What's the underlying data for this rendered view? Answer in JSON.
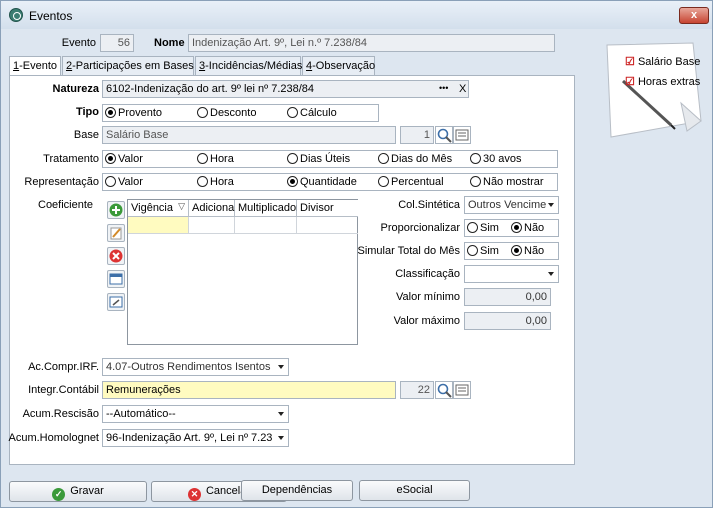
{
  "window": {
    "title": "Eventos",
    "close_label": "x"
  },
  "header": {
    "evento_label": "Evento",
    "evento_value": "56",
    "nome_label": "Nome",
    "nome_value": "Indenização Art. 9º, Lei n.º 7.238/84"
  },
  "tabs": [
    {
      "key": "1",
      "label": "-Evento"
    },
    {
      "key": "2",
      "label": "-Participações em Bases"
    },
    {
      "key": "3",
      "label": "-Incidências/Médias"
    },
    {
      "key": "4",
      "label": "-Observação"
    }
  ],
  "natureza": {
    "label": "Natureza",
    "value": "6102-Indenização do art. 9º lei nº 7.238/84",
    "dots": "•••",
    "clear": "X"
  },
  "tipo": {
    "label": "Tipo",
    "options": [
      "Provento",
      "Desconto",
      "Cálculo"
    ]
  },
  "base": {
    "label": "Base",
    "value": "Salário Base",
    "code": "1"
  },
  "tratamento": {
    "label": "Tratamento",
    "options": [
      "Valor",
      "Hora",
      "Dias Úteis",
      "Dias do Mês",
      "30 avos"
    ]
  },
  "representacao": {
    "label": "Representação",
    "options": [
      "Valor",
      "Hora",
      "Quantidade",
      "Percentual",
      "Não mostrar"
    ]
  },
  "coeficiente": {
    "label": "Coeficiente",
    "columns": [
      "Vigência",
      "Adicional",
      "Multiplicador",
      "Divisor"
    ]
  },
  "right": {
    "col_sintetica": {
      "label": "Col.Sintética",
      "value": "Outros Vencime"
    },
    "proporcionalizar": {
      "label": "Proporcionalizar",
      "options": [
        "Sim",
        "Não"
      ]
    },
    "simular": {
      "label": "Simular Total do Mês",
      "options": [
        "Sim",
        "Não"
      ]
    },
    "classificacao": {
      "label": "Classificação",
      "value": ""
    },
    "valor_minimo": {
      "label": "Valor mínimo",
      "value": "0,00"
    },
    "valor_maximo": {
      "label": "Valor máximo",
      "value": "0,00"
    }
  },
  "ac_compr": {
    "label": "Ac.Compr.IRF.",
    "value": "4.07-Outros Rendimentos Isentos"
  },
  "integr": {
    "label": "Integr.Contábil",
    "value": "Remunerações",
    "code": "22"
  },
  "acum_rescisao": {
    "label": "Acum.Rescisão",
    "value": "--Automático--"
  },
  "acum_homolog": {
    "label": "Acum.Homolognet",
    "value": "96-Indenização Art. 9º, Lei nº 7.23"
  },
  "buttons": {
    "gravar": "Gravar",
    "cancelar": "Cancelar",
    "dependencias": "Dependências",
    "esocial": "eSocial"
  },
  "sticky_note": {
    "items": [
      "Salário Base",
      "Horas extras"
    ]
  },
  "colors": {
    "yellow": "#fffbc0",
    "panel_bg": "#dde6f0"
  }
}
